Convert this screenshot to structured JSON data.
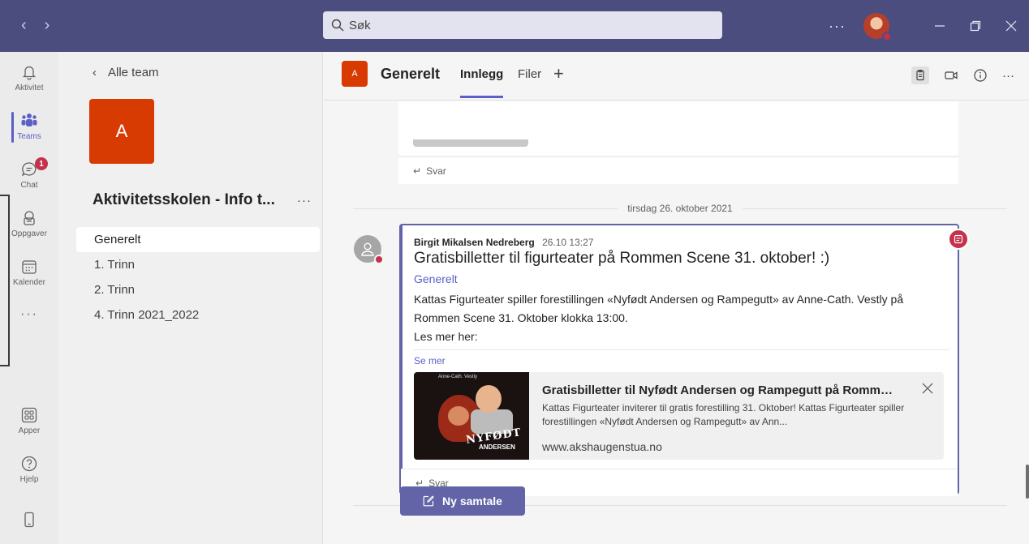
{
  "titlebar": {
    "search_placeholder": "Søk",
    "more": "···",
    "window_controls": [
      "minimize-icon",
      "restore-icon",
      "close-icon"
    ]
  },
  "rail": {
    "items": [
      {
        "label": "Aktivitet",
        "icon": "bell-icon"
      },
      {
        "label": "Teams",
        "icon": "teams-icon"
      },
      {
        "label": "Chat",
        "icon": "chat-icon",
        "badge": "1"
      },
      {
        "label": "Oppgaver",
        "icon": "tasks-icon"
      },
      {
        "label": "Kalender",
        "icon": "calendar-icon"
      },
      {
        "label": "Apper",
        "icon": "apps-icon"
      },
      {
        "label": "Hjelp",
        "icon": "help-icon"
      }
    ],
    "more": "···"
  },
  "team_panel": {
    "back_label": "Alle team",
    "team_initial": "A",
    "team_name": "Aktivitetsskolen - Info t...",
    "more": "···",
    "channels": [
      "Generelt",
      "1. Trinn",
      "2. Trinn",
      "4. Trinn 2021_2022"
    ]
  },
  "channel_header": {
    "logo_initial": "A",
    "title": "Generelt",
    "tabs": [
      "Innlegg",
      "Filer"
    ],
    "more": "···"
  },
  "feed": {
    "prev_reply_label": "Svar",
    "date_divider": "tirsdag 26. oktober 2021",
    "post": {
      "author": "Birgit Mikalsen Nedreberg",
      "time": "26.10 13:27",
      "title": "Gratisbilletter til figurteater på Rommen Scene 31. oktober! :)",
      "channel": "Generelt",
      "body_line1": "Kattas Figurteater spiller forestillingen «Nyfødt Andersen og Rampegutt» av Anne-Cath. Vestly på",
      "body_line2": "Rommen Scene 31. Oktober klokka 13:00.",
      "body_line3": "Les mer her:",
      "see_more": "Se mer",
      "link_preview": {
        "image_caption": "Anne-Cath. Vestly",
        "image_title": "NYFØDT",
        "image_subtitle": "ANDERSEN",
        "title": "Gratisbilletter til Nyfødt Andersen og Rampegutt på Rommen...",
        "description": "Kattas Figurteater inviterer til gratis forestilling 31. Oktober! Kattas Figurteater spiller forestillingen «Nyfødt Andersen og Rampegutt» av Ann...",
        "url": "www.akshaugenstua.no"
      },
      "reply_label": "Svar"
    },
    "new_conversation": "Ny samtale"
  },
  "colors": {
    "titlebar": "#4b4d7f",
    "accent": "#6264a7",
    "team_logo": "#d83b01",
    "badge": "#c4314b"
  }
}
